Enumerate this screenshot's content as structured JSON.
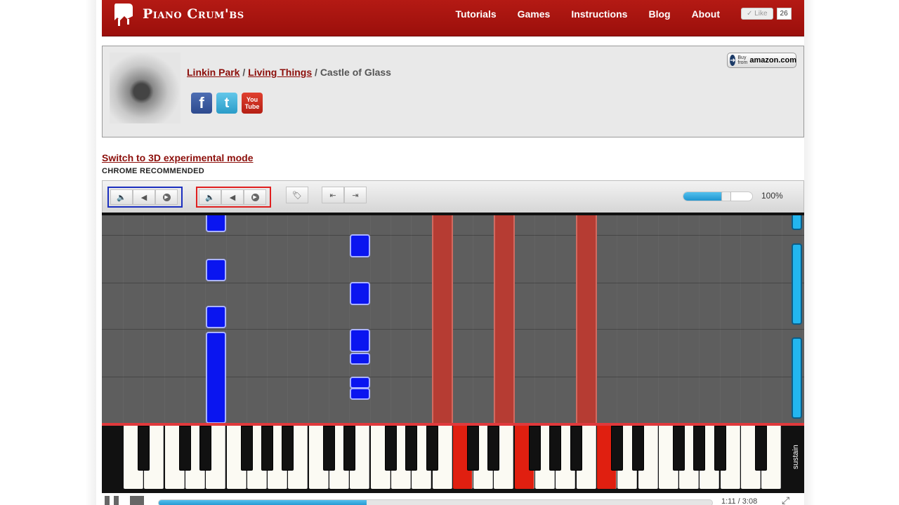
{
  "header": {
    "logo_text": "Piano Crum'bs",
    "nav": [
      {
        "label": "Tutorials"
      },
      {
        "label": "Games"
      },
      {
        "label": "Instructions"
      },
      {
        "label": "Blog"
      },
      {
        "label": "About"
      }
    ],
    "like_label": "Like",
    "like_count": "26"
  },
  "song": {
    "artist": "Linkin Park",
    "album": "Living Things",
    "separator": "/",
    "title": "Castle of Glass",
    "social": {
      "facebook": "f",
      "twitter": "t",
      "youtube_top": "You",
      "youtube_bottom": "Tube"
    },
    "amazon": {
      "buy_top": "Buy",
      "buy_bottom": "from",
      "name": "amazon.com"
    }
  },
  "mode_link": "Switch to 3D experimental mode",
  "chrome_note": "CHROME RECOMMENDED",
  "toolbar": {
    "left_hand": {
      "mute": "🔈",
      "prev": "◀",
      "play": "▶"
    },
    "right_hand": {
      "mute": "🔈",
      "prev": "◀",
      "play": "▶"
    },
    "tag": "🏷",
    "skip_back": "⇤",
    "skip_fwd": "⇥",
    "speed_fraction": 0.62,
    "zoom_label": "100%"
  },
  "roll": {
    "sustain_label": "sustain"
  },
  "player": {
    "progress_fraction": 0.375,
    "time_elapsed": "1:11",
    "time_separator": "/",
    "time_total": "3:08"
  },
  "colors": {
    "accent_red": "#a41410",
    "left_hand_blue": "#0a15f0",
    "right_hand_red": "#b63c33",
    "sustain_blue": "#23b6ef"
  }
}
